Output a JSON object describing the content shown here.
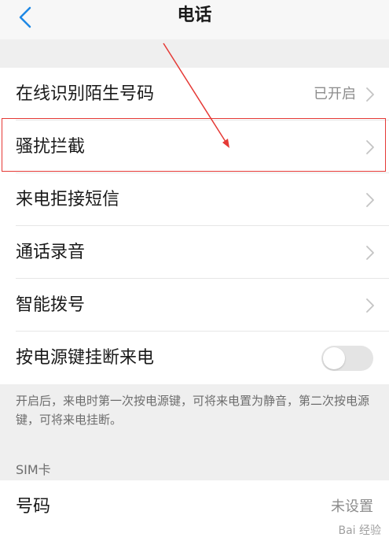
{
  "header": {
    "title": "电话"
  },
  "settings": {
    "items": [
      {
        "label": "在线识别陌生号码",
        "value": "已开启",
        "has_chevron": true
      },
      {
        "label": "骚扰拦截",
        "value": "",
        "has_chevron": true
      },
      {
        "label": "来电拒接短信",
        "value": "",
        "has_chevron": true
      },
      {
        "label": "通话录音",
        "value": "",
        "has_chevron": true
      },
      {
        "label": "智能拨号",
        "value": "",
        "has_chevron": true
      },
      {
        "label": "按电源键挂断来电",
        "toggle_on": false
      }
    ],
    "description": "开启后，来电时第一次按电源键，可将来电置为静音，第二次按电源键，可将来电挂断。"
  },
  "sim_section": {
    "header": "SIM卡",
    "items": [
      {
        "label": "号码",
        "value": "未设置"
      }
    ]
  },
  "watermark": "Bai 经验",
  "colors": {
    "accent": "#1e88e5",
    "highlight": "#e53935",
    "toggle_off": "#e4e4e4"
  }
}
